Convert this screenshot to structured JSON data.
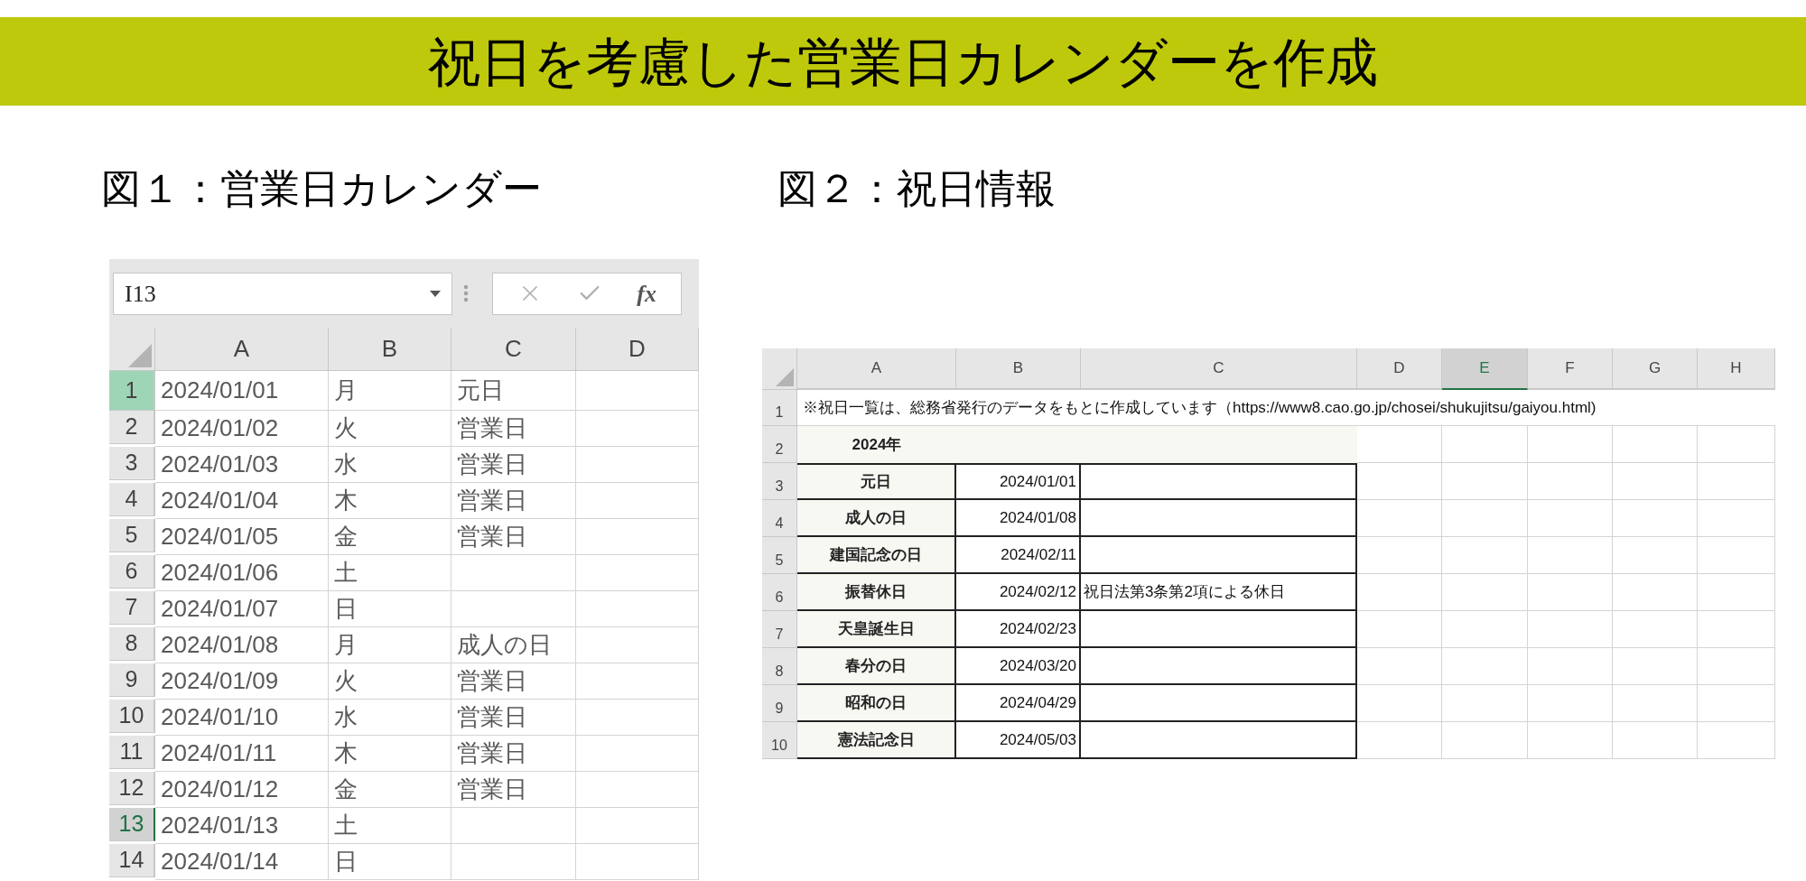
{
  "title": "祝日を考慮した営業日カレンダーを作成",
  "figure_1": {
    "caption": "図１：営業日カレンダー",
    "name_box": "I13",
    "function_label": "fx",
    "columns": [
      {
        "label": "A",
        "selected": false
      },
      {
        "label": "B",
        "selected": false
      },
      {
        "label": "C",
        "selected": false
      },
      {
        "label": "D",
        "selected": false
      }
    ],
    "rows": [
      {
        "number": "1",
        "highlighted": true,
        "selected": false,
        "cells": [
          "2024/01/01",
          "月",
          "元日"
        ]
      },
      {
        "number": "2",
        "highlighted": false,
        "selected": false,
        "cells": [
          "2024/01/02",
          "火",
          "営業日"
        ]
      },
      {
        "number": "3",
        "highlighted": false,
        "selected": false,
        "cells": [
          "2024/01/03",
          "水",
          "営業日"
        ]
      },
      {
        "number": "4",
        "highlighted": false,
        "selected": false,
        "cells": [
          "2024/01/04",
          "木",
          "営業日"
        ]
      },
      {
        "number": "5",
        "highlighted": false,
        "selected": false,
        "cells": [
          "2024/01/05",
          "金",
          "営業日"
        ]
      },
      {
        "number": "6",
        "highlighted": false,
        "selected": false,
        "cells": [
          "2024/01/06",
          "土"
        ]
      },
      {
        "number": "7",
        "highlighted": false,
        "selected": false,
        "cells": [
          "2024/01/07",
          "日"
        ]
      },
      {
        "number": "8",
        "highlighted": false,
        "selected": false,
        "cells": [
          "2024/01/08",
          "月",
          "成人の日"
        ]
      },
      {
        "number": "9",
        "highlighted": false,
        "selected": false,
        "cells": [
          "2024/01/09",
          "火",
          "営業日"
        ]
      },
      {
        "number": "10",
        "highlighted": false,
        "selected": false,
        "cells": [
          "2024/01/10",
          "水",
          "営業日"
        ]
      },
      {
        "number": "11",
        "highlighted": false,
        "selected": false,
        "cells": [
          "2024/01/11",
          "木",
          "営業日"
        ]
      },
      {
        "number": "12",
        "highlighted": false,
        "selected": false,
        "cells": [
          "2024/01/12",
          "金",
          "営業日"
        ]
      },
      {
        "number": "13",
        "highlighted": false,
        "selected": true,
        "cells": [
          "2024/01/13",
          "土"
        ]
      },
      {
        "number": "14",
        "highlighted": false,
        "selected": false,
        "cells": [
          "2024/01/14",
          "日"
        ]
      }
    ]
  },
  "figure_2": {
    "caption": "図２：祝日情報",
    "columns": [
      {
        "label": "A",
        "selected": false
      },
      {
        "label": "B",
        "selected": false
      },
      {
        "label": "C",
        "selected": false
      },
      {
        "label": "D",
        "selected": false
      },
      {
        "label": "E",
        "selected": true
      },
      {
        "label": "F",
        "selected": false
      },
      {
        "label": "G",
        "selected": false
      },
      {
        "label": "H",
        "selected": false
      }
    ],
    "note_row": {
      "number": "1",
      "text": "※祝日一覧は、総務省発行のデータをもとに作成しています（https://www8.cao.go.jp/chosei/shukujitsu/gaiyou.html)"
    },
    "year_row": {
      "number": "2",
      "text": "2024年"
    },
    "holidays": [
      {
        "number": "3",
        "name": "元日",
        "date": "2024/01/01"
      },
      {
        "number": "4",
        "name": "成人の日",
        "date": "2024/01/08"
      },
      {
        "number": "5",
        "name": "建国記念の日",
        "date": "2024/02/11"
      },
      {
        "number": "6",
        "name": "振替休日",
        "date": "2024/02/12",
        "remark": "祝日法第3条第2項による休日"
      },
      {
        "number": "7",
        "name": "天皇誕生日",
        "date": "2024/02/23"
      },
      {
        "number": "8",
        "name": "春分の日",
        "date": "2024/03/20"
      },
      {
        "number": "9",
        "name": "昭和の日",
        "date": "2024/04/29"
      },
      {
        "number": "10",
        "name": "憲法記念日",
        "date": "2024/05/03"
      }
    ]
  }
}
